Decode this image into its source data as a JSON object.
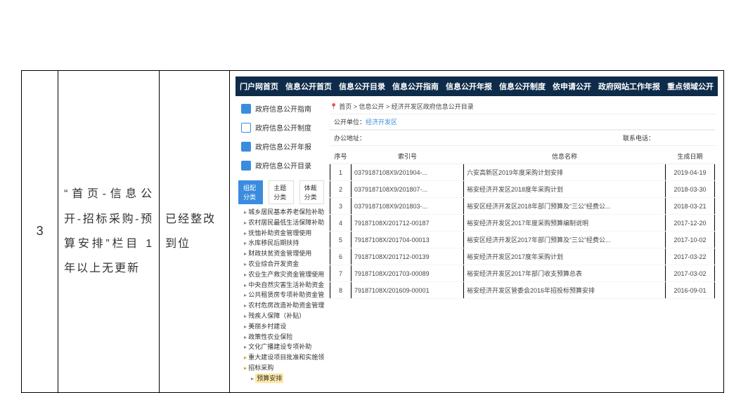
{
  "outer": {
    "num": "3",
    "desc": "“首页-信息公开-招标采购-预算安排”栏目 1年以上无更新",
    "status": "已经整改到位"
  },
  "topnav": [
    "门户网首页",
    "信息公开首页",
    "信息公开目录",
    "信息公开指南",
    "信息公开年报",
    "信息公开制度",
    "依申请公开",
    "政府网站工作年报",
    "重点领域公开"
  ],
  "side": {
    "items": [
      "政府信息公开指南",
      "政府信息公开制度",
      "政府信息公开年报",
      "政府信息公开目录"
    ],
    "tabs": [
      "组配分类",
      "主题分类",
      "体裁分类"
    ],
    "tree": [
      "城乡居民基本养老保险补助资金",
      "农村居民最低生活保障补助资金",
      "抚恤补助资金管理使用",
      "水库移民后期扶持",
      "财政扶贫资金管理使用",
      "农业综合开发资金",
      "农业生产救灾资金管理使用",
      "中央自然灾害生活补助资金管理使",
      "公共租赁房专项补助资金管理使用",
      "农村危房改造补助资金管理使用",
      "残疾人保障（补贴）",
      "美丽乡村建设",
      "政策性农业保险",
      "文化广播建设专项补助",
      "重大建设项目批准和实施领域",
      "招标采购"
    ],
    "treeSelected": "预算安排"
  },
  "crumb": {
    "prefix": "首页 > 信息公开 > ",
    "last": "经济开发区政府信息公开目录"
  },
  "info": {
    "unitLabel": "公开单位：",
    "unit": "经济开发区",
    "addrLabel": "办公地址：",
    "phoneLabel": "联系电话："
  },
  "headers": {
    "seq": "序号",
    "idx": "索引号",
    "name": "信息名称",
    "date": "生成日期"
  },
  "rows": [
    {
      "seq": "1",
      "idx": "0379187108X9/201904-...",
      "name": "六安高新区2019年度采购计划安排",
      "date": "2019-04-19"
    },
    {
      "seq": "2",
      "idx": "0379187108X9/201807-...",
      "name": "裕安经济开发区2018度年采购计划",
      "date": "2018-03-30"
    },
    {
      "seq": "3",
      "idx": "0379187108X9/201803-...",
      "name": "裕安区经济开发区2018年部门预算及“三公”经费公...",
      "date": "2018-03-21"
    },
    {
      "seq": "4",
      "idx": "79187108X/201712-00187",
      "name": "裕安经济开发区2017年度采购预算编制说明",
      "date": "2017-12-20"
    },
    {
      "seq": "5",
      "idx": "79187108X/201704-00013",
      "name": "裕安区经济开发区2017年部门预算及“三公”经费公...",
      "date": "2017-10-02"
    },
    {
      "seq": "6",
      "idx": "79187108X/201712-00139",
      "name": "裕安经济开发区2017度年采购计划",
      "date": "2017-03-22"
    },
    {
      "seq": "7",
      "idx": "79187108X/201703-00089",
      "name": "裕安经济开发区2017年部门收支预算总表",
      "date": "2017-03-02"
    },
    {
      "seq": "8",
      "idx": "79187108X/201609-00001",
      "name": "裕安经济开发区管委会2016年招投标预算安排",
      "date": "2016-09-01"
    }
  ]
}
